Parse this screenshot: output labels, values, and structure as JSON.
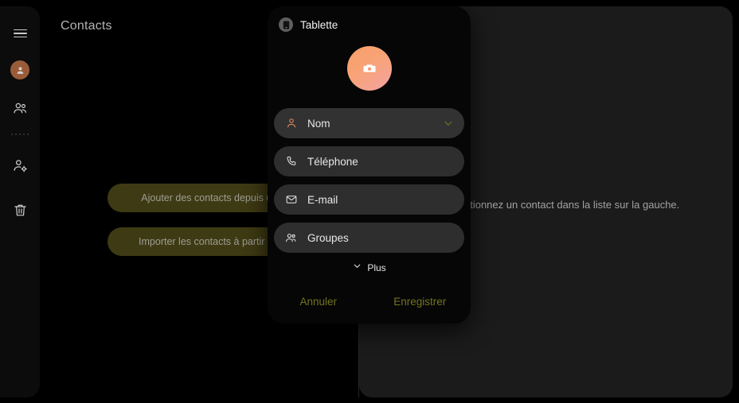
{
  "window": {
    "background": "#000000",
    "panel_bg": "#1b1b1b"
  },
  "sidebar": {
    "items": [
      {
        "name": "menu",
        "icon": "hamburger-icon",
        "label": "Menu"
      },
      {
        "name": "profile",
        "icon": "user-avatar-icon",
        "label": "Profil"
      },
      {
        "name": "groups",
        "icon": "groups-icon",
        "label": "Groupes"
      },
      {
        "name": "manage-contacts",
        "icon": "user-settings-icon",
        "label": "Gérer les contacts"
      },
      {
        "name": "trash",
        "icon": "trash-icon",
        "label": "Corbeille"
      }
    ]
  },
  "header": {
    "title": "Contacts"
  },
  "list_pane": {
    "actions": [
      {
        "label": "Ajouter des contacts depuis un compte",
        "color": "#3e3a13"
      },
      {
        "label": "Importer les contacts à partir d'un fichier",
        "color": "#3e3a13"
      }
    ]
  },
  "detail_pane": {
    "empty_text": "Sélectionnez un contact dans la liste sur la gauche."
  },
  "dialog": {
    "header": {
      "badge_icon": "tablet-icon",
      "label": "Tablette"
    },
    "avatar": {
      "icon": "camera-icon",
      "gradient_from": "#fa9f68",
      "gradient_to": "#f3a3a4"
    },
    "fields": [
      {
        "icon": "person-icon",
        "label": "Nom",
        "icon_color": "#e08a5a",
        "focused": true,
        "chevron": true
      },
      {
        "icon": "phone-icon",
        "label": "Téléphone",
        "icon_color": "#e8e8e8",
        "focused": false,
        "chevron": false
      },
      {
        "icon": "envelope-icon",
        "label": "E-mail",
        "icon_color": "#e8e8e8",
        "focused": false,
        "chevron": false
      },
      {
        "icon": "groups-icon",
        "label": "Groupes",
        "icon_color": "#e8e8e8",
        "focused": false,
        "chevron": false
      }
    ],
    "more": {
      "label": "Plus",
      "icon": "chevron-down-icon"
    },
    "footer": {
      "cancel_label": "Annuler",
      "save_label": "Enregistrer",
      "accent": "#74741f"
    }
  }
}
